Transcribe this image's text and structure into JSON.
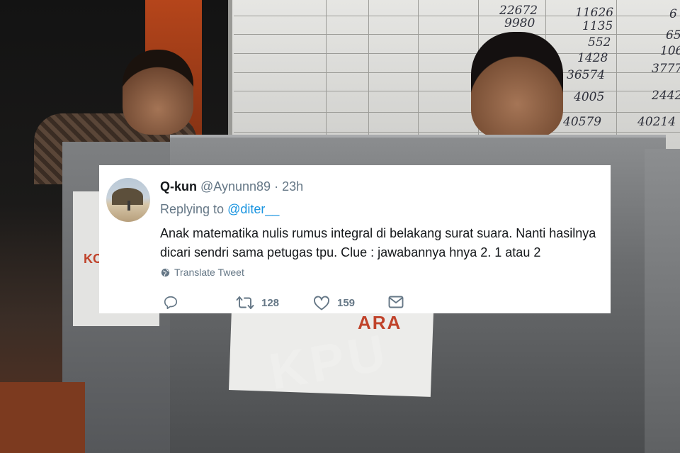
{
  "tweet": {
    "display_name": "Q-kun",
    "handle": "@Aynunn89",
    "separator": "·",
    "time": "23h",
    "reply_prefix": "Replying to",
    "reply_to": "@diter__",
    "text": "Anak matematika nulis rumus integral di belakang surat suara. Nanti hasilnya dicari sendri sama petugas tpu. Clue : jawabannya hnya 2. 1 atau 2",
    "translate_label": "Translate Tweet",
    "retweet_count": "128",
    "like_count": "159",
    "icons": {
      "avatar": "profile-photo",
      "translate": "globe-icon",
      "reply": "reply-icon",
      "retweet": "retweet-icon",
      "like": "heart-icon",
      "dm": "envelope-icon"
    },
    "colors": {
      "link": "#1b95e0",
      "secondary_text": "#657786",
      "primary_text": "#14171a"
    }
  },
  "background": {
    "board_numbers": [
      "22672",
      "11626",
      "9980",
      "1135",
      "552",
      "1428",
      "36574",
      "4005",
      "2442",
      "40579",
      "40214",
      "106",
      "3777",
      "65",
      "6"
    ],
    "left_label": "KOT",
    "box_label": "ARA",
    "box_emboss": "KPU"
  }
}
